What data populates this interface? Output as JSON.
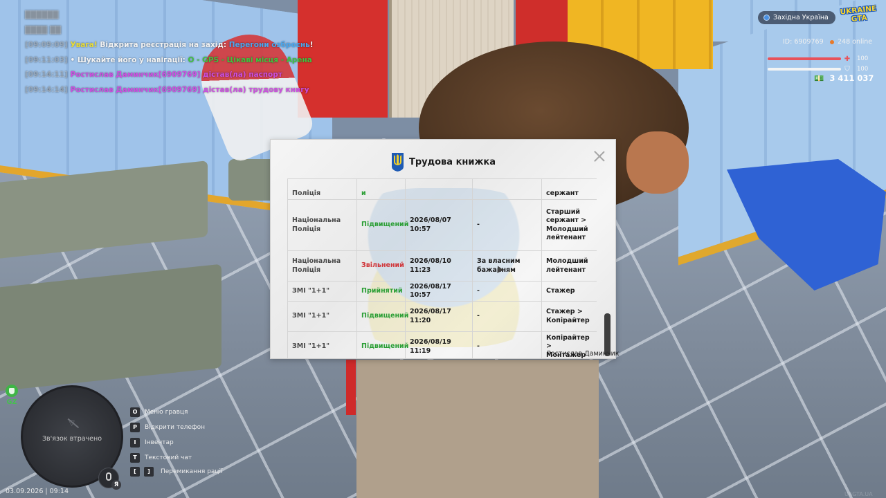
{
  "chat": {
    "faded_lines": [
      "██████",
      "████ ██"
    ],
    "lines": [
      {
        "ts": "[09:09:09]",
        "parts": [
          {
            "text": "Увага! ",
            "color": "yellow"
          },
          {
            "text": "Відкрита реєстрація на захід: ",
            "color": "white"
          },
          {
            "text": "Перегони озброєнь",
            "color": "blue"
          },
          {
            "text": "!",
            "color": "white"
          }
        ]
      },
      {
        "ts": "[09:11:03]",
        "parts": [
          {
            "text": "• Шукайте його у навігації: ",
            "color": "white"
          },
          {
            "text": "O - GPS - Цікаві місця - Арена",
            "color": "green"
          }
        ]
      },
      {
        "ts": "[09:14:11]",
        "parts": [
          {
            "text": "Ростислав Даминчик[6909769] дістав(ла) паспорт",
            "color": "magenta"
          }
        ]
      },
      {
        "ts": "[09:14:14]",
        "parts": [
          {
            "text": "Ростислав Даминчик[6909769] дістав(ла) трудову книгу",
            "color": "magenta"
          }
        ]
      }
    ]
  },
  "hud": {
    "region": "Західна Україна",
    "logo_line1": "UKRAINE",
    "logo_line2": "GTA",
    "player_id": "ID: 6909769",
    "online": "248 online",
    "health_value": "100",
    "armor_value": "100",
    "health_fraction": 1.0,
    "armor_fraction": 1.0,
    "money": "3 411 037"
  },
  "workbook": {
    "title": "Трудова книжка",
    "rows": [
      {
        "org": "Поліція",
        "action": "и",
        "action_color": "green",
        "date": "",
        "reason": "",
        "rank": "сержант",
        "partial": true
      },
      {
        "org": "Національна Поліція",
        "action": "Підвищений",
        "action_color": "green",
        "date": "2026/08/07 10:57",
        "reason": "-",
        "rank": "Старший сержант > Молодший лейтенант"
      },
      {
        "org": "Національна Поліція",
        "action": "Звільнений",
        "action_color": "red",
        "date": "2026/08/10 11:23",
        "reason": "За власним бажанням",
        "rank": "Молодший лейтенант"
      },
      {
        "org": "ЗМІ \"1+1\"",
        "action": "Прийнятий",
        "action_color": "green",
        "date": "2026/08/17 10:57",
        "reason": "-",
        "rank": "Стажер"
      },
      {
        "org": "ЗМІ \"1+1\"",
        "action": "Підвищений",
        "action_color": "green",
        "date": "2026/08/17 11:20",
        "reason": "-",
        "rank": "Стажер > Копірайтер"
      },
      {
        "org": "ЗМІ \"1+1\"",
        "action": "Підвищений",
        "action_color": "green",
        "date": "2026/08/19 11:19",
        "reason": "-",
        "rank": "Копірайтер > Монтажер"
      }
    ],
    "owner": "Ростислав Даминчик"
  },
  "zone_label": "GZ",
  "minimap": {
    "status": "Зв'язок втрачено",
    "mic_badge": "Я"
  },
  "hints": [
    {
      "keys": [
        "O"
      ],
      "label": "Меню гравця"
    },
    {
      "keys": [
        "P"
      ],
      "label": "Відкрити телефон"
    },
    {
      "keys": [
        "I"
      ],
      "label": "Інвентар"
    },
    {
      "keys": [
        "T"
      ],
      "label": "Текстовий чат"
    },
    {
      "keys": [
        "[",
        "]"
      ],
      "label": "Перемикання рації"
    }
  ],
  "datetime": "03.09.2026 | 09:14",
  "watermark": "UAGTA.UA",
  "colors": {
    "yellow": "#e8dd3a",
    "white": "#f4f4f4",
    "blue": "#4aa8f0",
    "green": "#3fc43f",
    "magenta": "#cc4ee0",
    "health": "#e8525a",
    "armor": "#f4f4f4"
  }
}
